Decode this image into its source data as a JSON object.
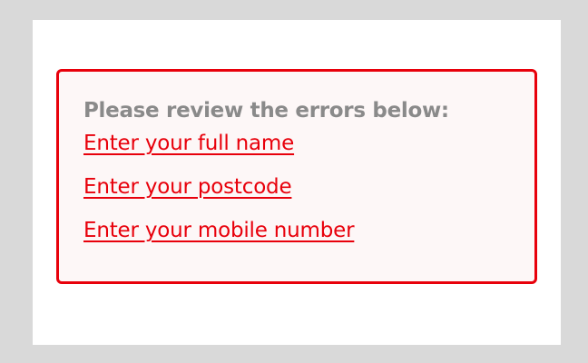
{
  "error_summary": {
    "heading": "Please review the errors below:",
    "errors": [
      {
        "label": "Enter your full name"
      },
      {
        "label": "Enter your postcode"
      },
      {
        "label": "Enter your mobile number"
      }
    ]
  },
  "colors": {
    "page_background": "#d9d9d9",
    "card_background": "#ffffff",
    "summary_background": "#fdf7f7",
    "error_accent": "#e8000b",
    "heading_text": "#8a8a8a"
  }
}
